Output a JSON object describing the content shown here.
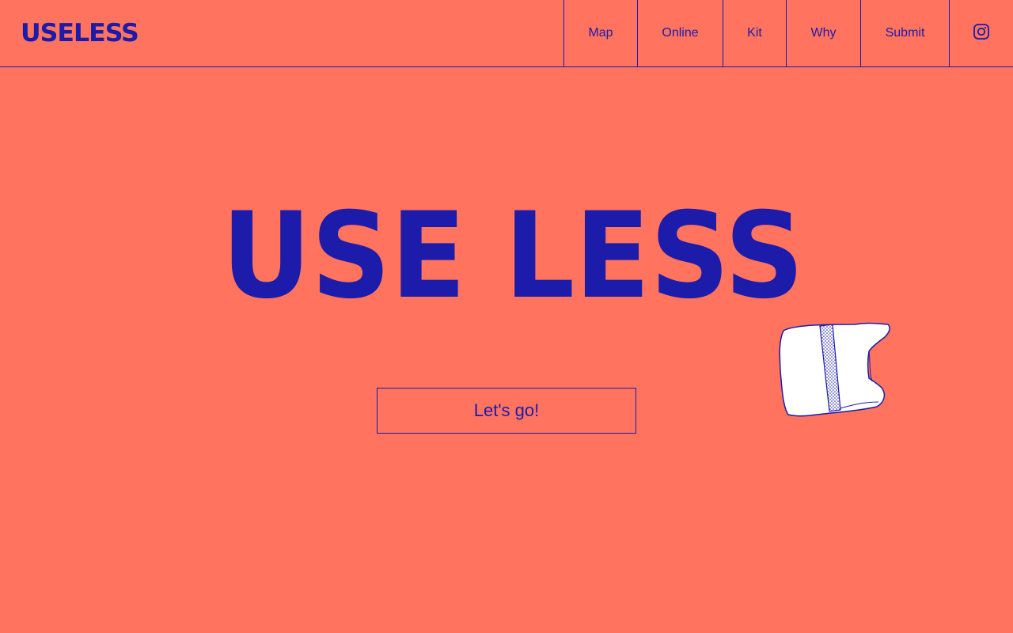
{
  "header": {
    "logo_text": "USELESS",
    "nav": [
      {
        "label": "Map"
      },
      {
        "label": "Online"
      },
      {
        "label": "Kit"
      },
      {
        "label": "Why"
      },
      {
        "label": "Submit"
      }
    ],
    "social_icon": "instagram-icon"
  },
  "hero": {
    "title": "USE LESS",
    "cta_label": "Let's go!",
    "illustration": "plastic-bag-illustration"
  },
  "colors": {
    "background": "#FF735F",
    "accent": "#1C1BAA",
    "illustration_fill": "#FFFFFF"
  }
}
